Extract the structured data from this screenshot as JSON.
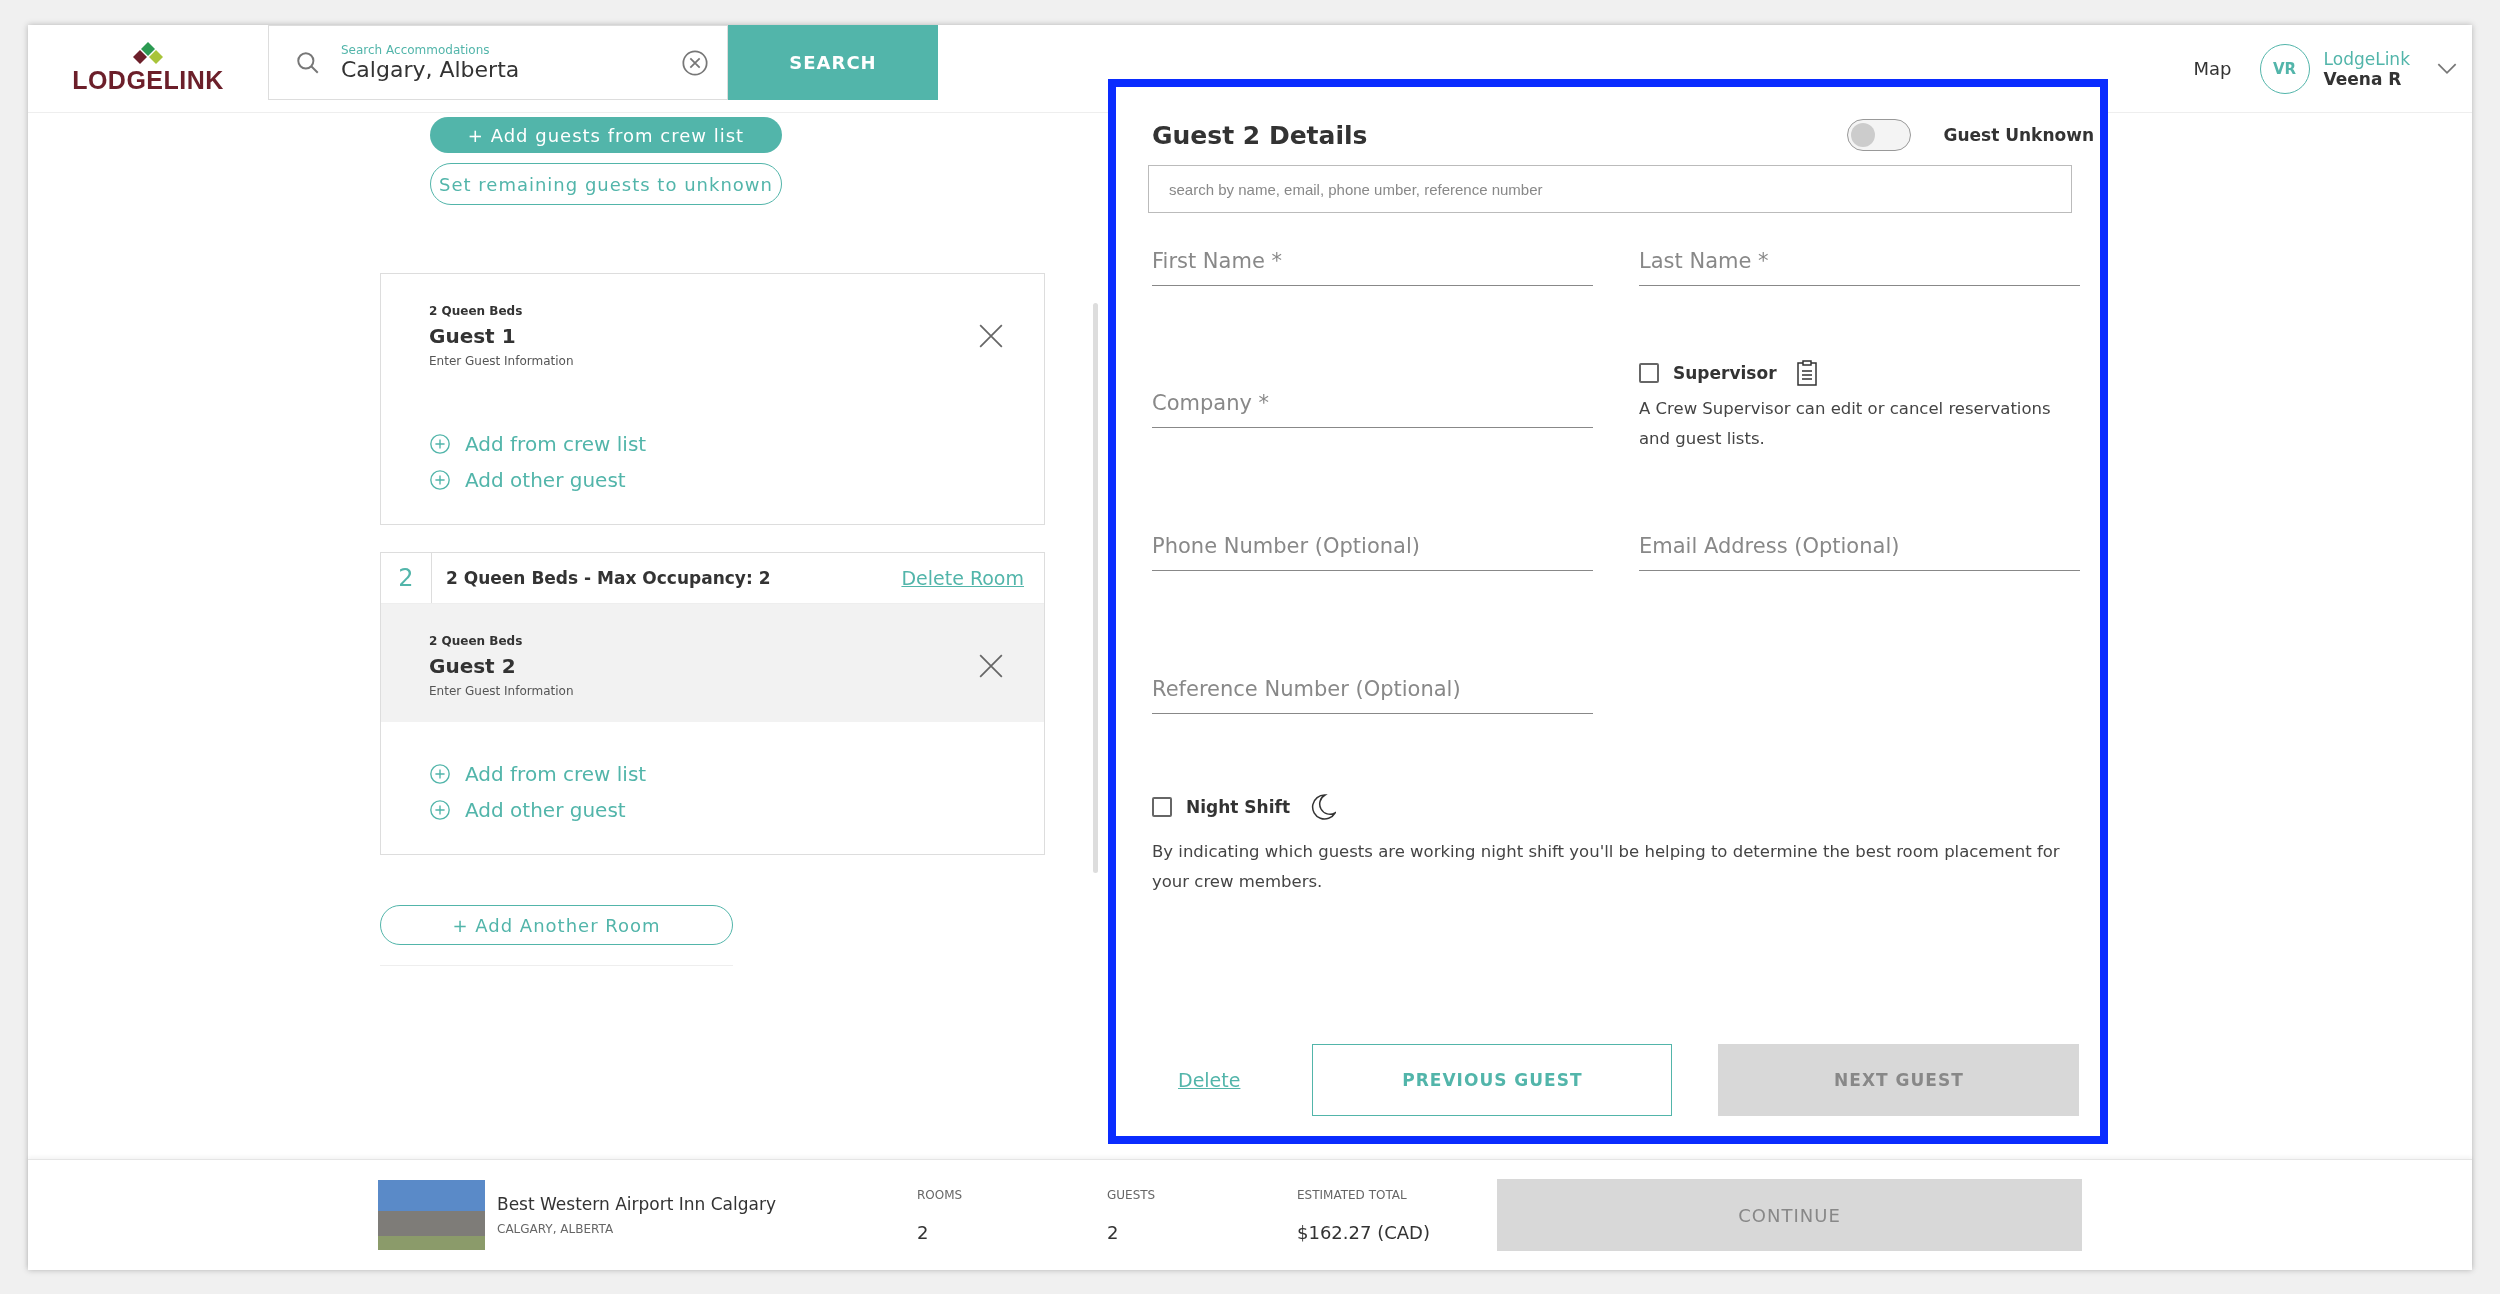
{
  "header": {
    "logo": "LODGELINK",
    "search": {
      "label": "Search Accommodations",
      "value": "Calgary, Alberta"
    },
    "search_button": "SEARCH",
    "map_link": "Map",
    "user": {
      "initials": "VR",
      "company": "LodgeLink",
      "name": "Veena R"
    }
  },
  "guest_actions": {
    "add_from_crew": "+ Add guests from crew list",
    "set_unknown": "Set remaining guests to unknown"
  },
  "rooms": [
    {
      "guests": [
        {
          "bed": "2 Queen Beds",
          "name": "Guest 1",
          "hint": "Enter Guest Information",
          "selected": false
        }
      ],
      "links": [
        "Add from crew list",
        "Add other guest"
      ]
    },
    {
      "number": "2",
      "title": "2 Queen Beds - Max Occupancy: 2",
      "delete": "Delete Room",
      "guests": [
        {
          "bed": "2 Queen Beds",
          "name": "Guest 2",
          "hint": "Enter Guest Information",
          "selected": true
        }
      ],
      "links": [
        "Add from crew list",
        "Add other guest"
      ]
    }
  ],
  "add_room": "+ Add Another Room",
  "details": {
    "title": "Guest 2 Details",
    "guest_unknown": {
      "label": "Guest Unknown",
      "on": false
    },
    "search_placeholder": "search by name, email, phone umber, reference number",
    "fields": [
      {
        "placeholder": "First Name *"
      },
      {
        "placeholder": "Last Name *"
      },
      {
        "placeholder": "Company *"
      },
      {
        "placeholder": "Phone Number (Optional)"
      },
      {
        "placeholder": "Email Address (Optional)"
      },
      {
        "placeholder": "Reference Number (Optional)"
      }
    ],
    "supervisor": {
      "label": "Supervisor",
      "checked": false,
      "note": "A Crew Supervisor can edit or cancel reservations and guest lists."
    },
    "night_shift": {
      "label": "Night Shift",
      "checked": false,
      "note": "By indicating which guests are working night shift you'll be helping to determine the best room placement for your crew members."
    },
    "delete": "Delete",
    "previous": "PREVIOUS GUEST",
    "next": {
      "label": "NEXT GUEST",
      "disabled": true
    }
  },
  "footer": {
    "hotel": "Best Western Airport Inn Calgary",
    "city": "CALGARY, ALBERTA",
    "stats": [
      {
        "label": "ROOMS",
        "value": "2"
      },
      {
        "label": "GUESTS",
        "value": "2"
      },
      {
        "label": "ESTIMATED TOTAL",
        "value": "$162.27 (CAD)"
      }
    ],
    "continue": {
      "label": "CONTINUE",
      "disabled": true
    }
  }
}
